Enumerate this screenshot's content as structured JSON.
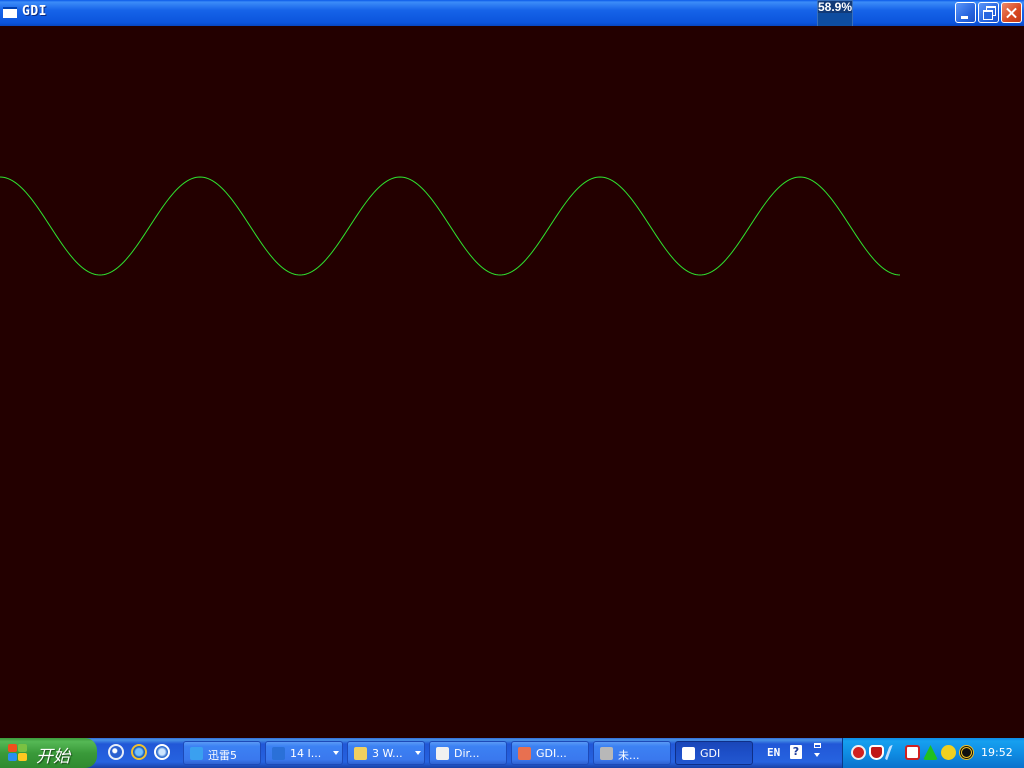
{
  "window": {
    "title": "GDI",
    "cpu_meter": {
      "label": "58.9%",
      "fraction": 0.589
    }
  },
  "colors": {
    "background": "#230000",
    "wave": "#2fe32f",
    "titlebar": "#0b54dc",
    "taskbar": "#2663e0",
    "tray": "#0f8de4"
  },
  "icons": {
    "title": "window-icon",
    "minimize": "minimize-icon",
    "maximize": "restore-icon",
    "close": "close-icon"
  },
  "taskbar": {
    "start_label": "开始",
    "quick_launch": [
      "media-player-icon",
      "ie-icon",
      "ie-alt-icon"
    ],
    "tasks": [
      {
        "label": "迅雷5",
        "icon": "thunder-icon",
        "active": false,
        "group": false
      },
      {
        "label": "14 I...",
        "icon": "ie-icon",
        "active": false,
        "group": true
      },
      {
        "label": "3 W...",
        "icon": "folder-icon",
        "active": false,
        "group": true
      },
      {
        "label": "Dir...",
        "icon": "help-doc-icon",
        "active": false,
        "group": false
      },
      {
        "label": "GDI...",
        "icon": "paint-icon",
        "active": false,
        "group": false
      },
      {
        "label": "未...",
        "icon": "app-icon",
        "active": false,
        "group": false
      },
      {
        "label": "GDI",
        "icon": "window-icon",
        "active": true,
        "group": false
      }
    ],
    "language": "EN",
    "help_glyph": "?",
    "clock": "19:52"
  }
}
